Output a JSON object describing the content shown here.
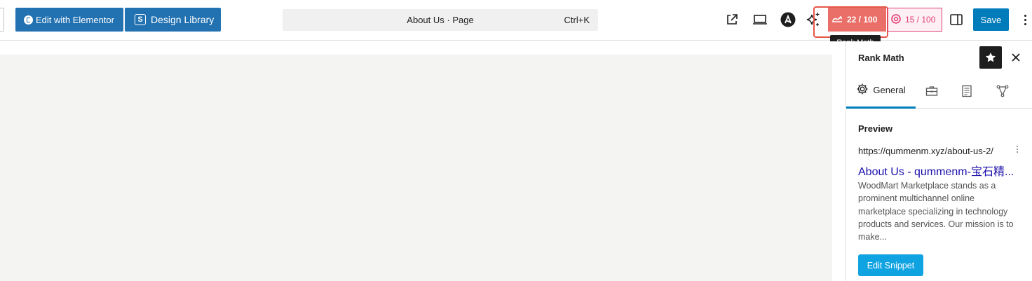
{
  "toolbar": {
    "edit_elementor_label": "Edit with Elementor",
    "design_library_label": "Design Library",
    "command_title": "About Us · Page",
    "command_shortcut": "Ctrl+K",
    "rank_math_score": "22 / 100",
    "content_ai_score": "15 / 100",
    "save_label": "Save",
    "icons": [
      "external-link-icon",
      "desktop-preview-icon",
      "astra-logo-icon",
      "ai-sparkle-icon",
      "rank-math-icon",
      "content-ai-icon",
      "sidebar-toggle-icon",
      "more-vertical-icon"
    ]
  },
  "tooltip": {
    "text": "Rank Math"
  },
  "sidebar": {
    "title": "Rank Math",
    "tabs": [
      {
        "label": "General",
        "icon": "gear-icon",
        "active": true
      },
      {
        "label": "",
        "icon": "toolbox-icon"
      },
      {
        "label": "",
        "icon": "schema-icon"
      },
      {
        "label": "",
        "icon": "social-share-icon"
      }
    ],
    "preview": {
      "section_title": "Preview",
      "url": "https://qummenm.xyz/about-us-2/",
      "title": "About Us - qummenm-宝石精...",
      "description": "WoodMart Marketplace stands as a prominent multichannel online marketplace specializing in technology products and services. Our mission is to make...",
      "edit_button": "Edit Snippet"
    }
  },
  "colors": {
    "wp_blue": "#2271b1",
    "save_blue": "#007cba",
    "rank_math_score_bg": "#ea6f69",
    "highlight_border": "#e5574a",
    "content_ai_pink": "#e23e79",
    "serp_link": "#1a0dab",
    "snippet_button": "#10a3e2",
    "canvas_bg": "#f4f5f2"
  }
}
